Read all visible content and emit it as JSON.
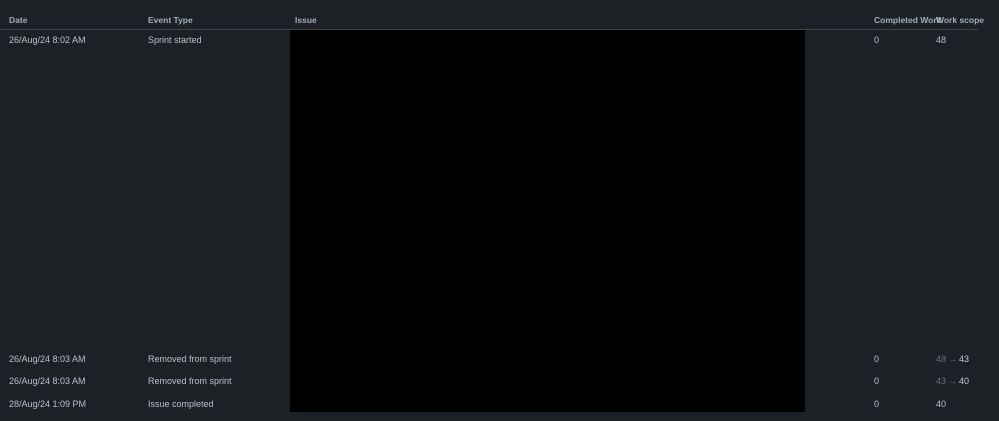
{
  "table": {
    "headers": {
      "date": "Date",
      "event_type": "Event Type",
      "issue": "Issue",
      "completed_work": "Completed Work",
      "work_scope": "Work scope"
    },
    "rows": [
      {
        "date": "26/Aug/24 8:02 AM",
        "event_type": "Sprint started",
        "completed_work": "0",
        "work_scope": "48"
      },
      {
        "date": "26/Aug/24 8:03 AM",
        "event_type": "Removed from sprint",
        "completed_work": "0",
        "work_scope_old": "48",
        "arrow": "→",
        "work_scope_new": "43"
      },
      {
        "date": "26/Aug/24 8:03 AM",
        "event_type": "Removed from sprint",
        "completed_work": "0",
        "work_scope_old": "43",
        "arrow": "→",
        "work_scope_new": "40"
      },
      {
        "date": "28/Aug/24 1:09 PM",
        "event_type": "Issue completed",
        "completed_work": "0",
        "work_scope": "40"
      }
    ]
  },
  "colors": {
    "background": "#1d2125",
    "text": "#b6c2cf",
    "header_text": "#9fadbc",
    "muted": "#626f7c",
    "redaction": "#000000"
  }
}
